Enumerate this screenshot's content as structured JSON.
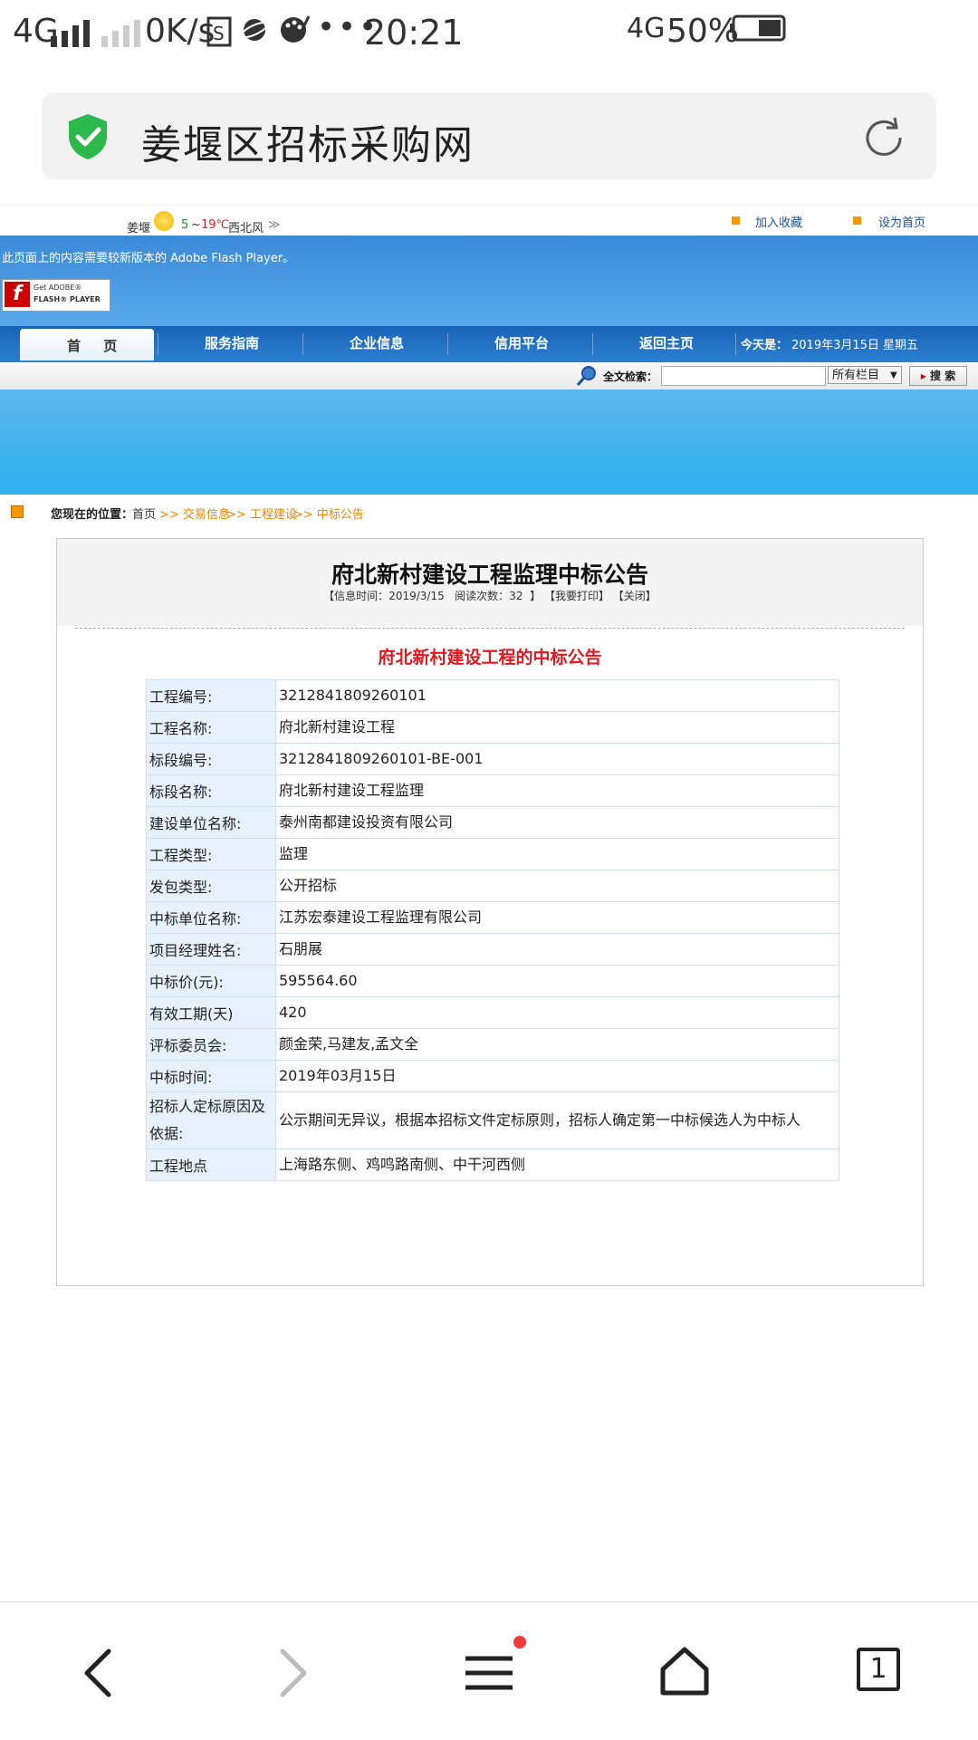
{
  "status_bar": {
    "network": "4G",
    "speed": "0K/s",
    "time": "20:21",
    "network2": "4G",
    "battery": "50%"
  },
  "browser": {
    "page_title": "姜堰区招标采购网",
    "tab_count": "1"
  },
  "site": {
    "weather_city": "姜堰",
    "temp_low": "5",
    "temp_sep": "~",
    "temp_high": "19℃",
    "wind": "西北风",
    "add_favorite": "加入收藏",
    "set_home": "设为首页",
    "flash_notice": "此页面上的内容需要较新版本的 Adobe Flash Player。",
    "flash_button_line1": "Get ADOBE®",
    "flash_button_line2": "FLASH® PLAYER",
    "nav": [
      "首 页",
      "服务指南",
      "企业信息",
      "信用平台",
      "返回主页"
    ],
    "today_label": "今天是：",
    "today_value": "2019年3月15日 星期五",
    "search_label": "全文检索：",
    "search_scope": "所有栏目",
    "search_button": "搜 索"
  },
  "breadcrumb": {
    "label": "您现在的位置：",
    "items": [
      "首页",
      ">> 交易信息",
      ">> 工程建设",
      ">> 中标公告"
    ]
  },
  "article": {
    "title": "府北新村建设工程监理中标公告",
    "meta_time_label": "【信息时间：",
    "meta_time": "2019/3/15",
    "meta_reads_label": "阅读次数：",
    "meta_reads": "32",
    "meta_end": "】",
    "print_label": "【我要打印】",
    "close_label": "【关闭】",
    "subtitle": "府北新村建设工程的中标公告",
    "rows": [
      {
        "label": "工程编号:",
        "value": "3212841809260101"
      },
      {
        "label": "工程名称:",
        "value": "府北新村建设工程"
      },
      {
        "label": "标段编号:",
        "value": "3212841809260101-BE-001"
      },
      {
        "label": "标段名称:",
        "value": "府北新村建设工程监理"
      },
      {
        "label": "建设单位名称:",
        "value": "泰州南都建设投资有限公司"
      },
      {
        "label": "工程类型:",
        "value": "监理"
      },
      {
        "label": "发包类型:",
        "value": "公开招标"
      },
      {
        "label": "中标单位名称:",
        "value": "江苏宏泰建设工程监理有限公司"
      },
      {
        "label": "项目经理姓名:",
        "value": "石朋展"
      },
      {
        "label": "中标价(元):",
        "value": "595564.60"
      },
      {
        "label": "有效工期(天)",
        "value": "420"
      },
      {
        "label": "评标委员会:",
        "value": "颜金荣,马建友,孟文全"
      },
      {
        "label": "中标时间:",
        "value": "2019年03月15日"
      },
      {
        "label": "招标人定标原因及依据:",
        "value": "公示期间无异议，根据本招标文件定标原则，招标人确定第一中标候选人为中标人"
      },
      {
        "label": "工程地点",
        "value": "上海路东侧、鸡鸣路南侧、中干河西侧"
      }
    ]
  },
  "colors": {
    "nav_blue": "#1a63b8",
    "banner_blue": "#3b8ad8",
    "subtitle_red": "#e3171e",
    "breadcrumb_orange": "#f08300",
    "secure_green": "#2db84d"
  },
  "icons": [
    "signal-icon",
    "sim-card-icon",
    "planet-icon",
    "palette-icon",
    "more-icon",
    "battery-icon",
    "shield-check-icon",
    "refresh-icon",
    "search-magnifier-icon",
    "back-icon",
    "forward-icon",
    "menu-icon",
    "home-icon",
    "tabs-icon"
  ]
}
